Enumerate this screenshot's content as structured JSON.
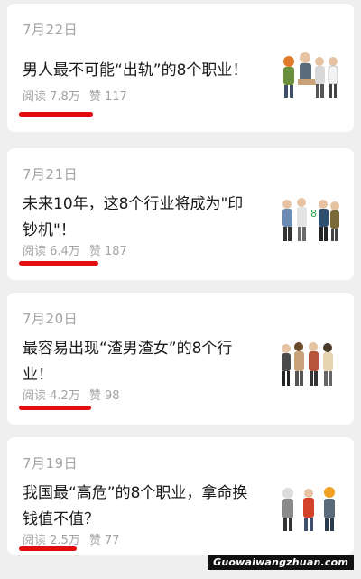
{
  "articles": [
    {
      "date": "7月22日",
      "title": "男人最不可能“出轨”的8个职业！",
      "reads": "阅读 7.8万",
      "likes": "赞 117"
    },
    {
      "date": "7月21日",
      "title": "未来10年，这8个行业将成为\"印钞机\"！",
      "reads": "阅读 6.4万",
      "likes": "赞 187"
    },
    {
      "date": "7月20日",
      "title": "最容易出现“渣男渣女”的8个行业！",
      "reads": "阅读 4.2万",
      "likes": "赞 98"
    },
    {
      "date": "7月19日",
      "title": "我国最“高危”的8个职业，拿命换钱值不值？",
      "reads": "阅读 2.5万",
      "likes": "赞 77"
    }
  ],
  "watermark": "Guowaiwangzhuan.com",
  "colors": {
    "background": "#efefef",
    "card": "#ffffff",
    "underline": "#e30d0d",
    "muted_text": "#a3a3a3",
    "title_text": "#1a1a1a"
  }
}
